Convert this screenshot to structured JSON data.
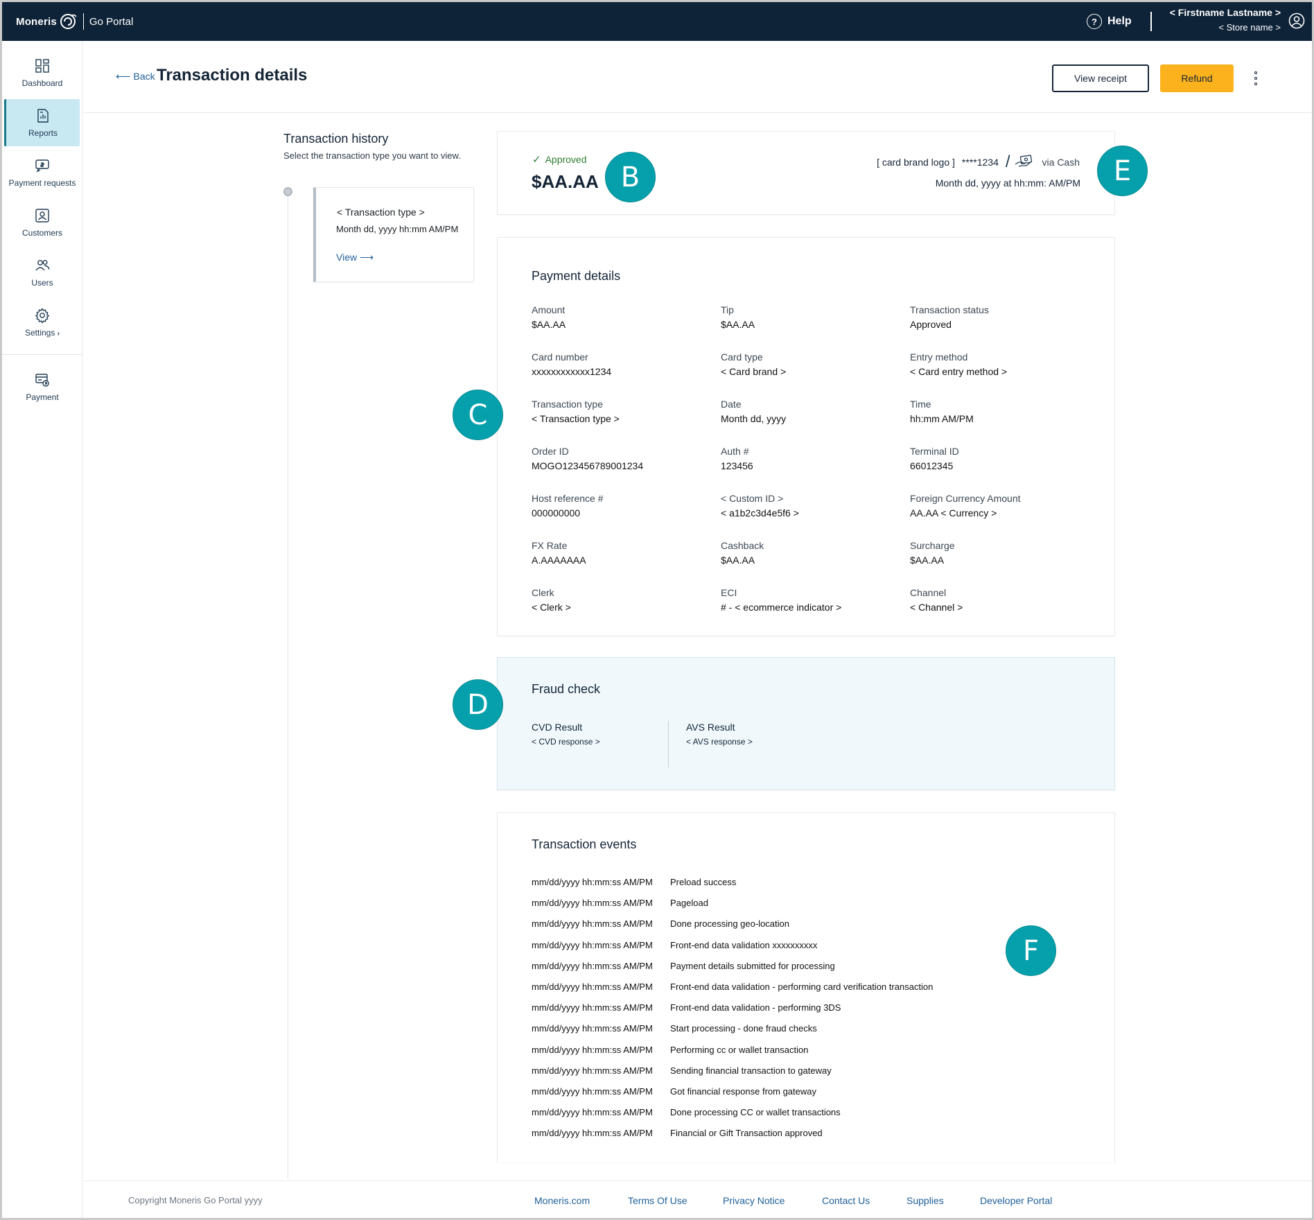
{
  "topbar": {
    "logo_text": "Moneris",
    "portal_name": "Go Portal",
    "help_label": "Help",
    "user_name": "< Firstname Lastname >",
    "store_name": "< Store name >"
  },
  "sidebar": {
    "items": [
      {
        "label": "Dashboard",
        "icon": "dashboard-icon"
      },
      {
        "label": "Reports",
        "icon": "reports-icon",
        "active": true
      },
      {
        "label": "Payment requests",
        "icon": "payment-request-icon"
      },
      {
        "label": "Customers",
        "icon": "customers-icon"
      },
      {
        "label": "Users",
        "icon": "users-icon"
      },
      {
        "label": "Settings",
        "icon": "gear-icon"
      },
      {
        "label": "Payment",
        "icon": "payment-icon"
      }
    ]
  },
  "header": {
    "back_label": "Back",
    "title": "Transaction details",
    "view_receipt_label": "View receipt",
    "refund_label": "Refund"
  },
  "history": {
    "title": "Transaction history",
    "subtitle": "Select the transaction type you want to view.",
    "entry": {
      "type": "< Transaction type >",
      "date": "Month dd, yyyy hh:mm AM/PM",
      "view_label": "View"
    }
  },
  "summary": {
    "status": "Approved",
    "amount": "$AA.AA",
    "card_brand": "[ card brand logo ]",
    "card_last4": "****1234",
    "via": "via Cash",
    "datetime": "Month dd, yyyy at hh:mm: AM/PM"
  },
  "payment_details": {
    "title": "Payment details",
    "fields": [
      {
        "label": "Amount",
        "value": "$AA.AA"
      },
      {
        "label": "Tip",
        "value": "$AA.AA"
      },
      {
        "label": "Transaction status",
        "value": "Approved"
      },
      {
        "label": "Card number",
        "value": "xxxxxxxxxxxx1234"
      },
      {
        "label": "Card type",
        "value": "< Card brand >"
      },
      {
        "label": "Entry method",
        "value": "< Card entry method >"
      },
      {
        "label": "Transaction type",
        "value": "< Transaction type >"
      },
      {
        "label": "Date",
        "value": "Month dd, yyyy"
      },
      {
        "label": "Time",
        "value": "hh:mm AM/PM"
      },
      {
        "label": "Order ID",
        "value": "MOGO123456789001234"
      },
      {
        "label": "Auth #",
        "value": "123456"
      },
      {
        "label": "Terminal ID",
        "value": "66012345"
      },
      {
        "label": "Host reference #",
        "value": "000000000"
      },
      {
        "label": "< Custom ID >",
        "value": "< a1b2c3d4e5f6 >"
      },
      {
        "label": "Foreign Currency Amount",
        "value": "AA.AA < Currency >"
      },
      {
        "label": "FX Rate",
        "value": "A.AAAAAAA"
      },
      {
        "label": "Cashback",
        "value": "$AA.AA"
      },
      {
        "label": "Surcharge",
        "value": "$AA.AA"
      },
      {
        "label": "Clerk",
        "value": "< Clerk >"
      },
      {
        "label": "ECI",
        "value": "# - < ecommerce indicator >"
      },
      {
        "label": "Channel",
        "value": "< Channel >"
      }
    ]
  },
  "fraud_check": {
    "title": "Fraud check",
    "cvd_label": "CVD Result",
    "cvd_value": "< CVD response >",
    "avs_label": "AVS Result",
    "avs_value": "< AVS response >"
  },
  "events": {
    "title": "Transaction events",
    "rows": [
      {
        "time": "mm/dd/yyyy hh:mm:ss AM/PM",
        "text": "Preload success"
      },
      {
        "time": "mm/dd/yyyy hh:mm:ss AM/PM",
        "text": "Pageload"
      },
      {
        "time": "mm/dd/yyyy hh:mm:ss AM/PM",
        "text": "Done processing geo-location"
      },
      {
        "time": "mm/dd/yyyy hh:mm:ss AM/PM",
        "text": "Front-end data validation xxxxxxxxxx"
      },
      {
        "time": "mm/dd/yyyy hh:mm:ss AM/PM",
        "text": "Payment details submitted for processing"
      },
      {
        "time": "mm/dd/yyyy hh:mm:ss AM/PM",
        "text": "Front-end data validation - performing card verification transaction"
      },
      {
        "time": "mm/dd/yyyy hh:mm:ss AM/PM",
        "text": "Front-end data validation - performing 3DS"
      },
      {
        "time": "mm/dd/yyyy hh:mm:ss AM/PM",
        "text": "Start processing - done fraud checks"
      },
      {
        "time": "mm/dd/yyyy hh:mm:ss AM/PM",
        "text": "Performing cc or wallet transaction"
      },
      {
        "time": "mm/dd/yyyy hh:mm:ss AM/PM",
        "text": "Sending financial transaction to gateway"
      },
      {
        "time": "mm/dd/yyyy hh:mm:ss AM/PM",
        "text": "Got financial response from gateway"
      },
      {
        "time": "mm/dd/yyyy hh:mm:ss AM/PM",
        "text": "Done processing CC or wallet transactions"
      },
      {
        "time": "mm/dd/yyyy hh:mm:ss AM/PM",
        "text": "Financial or Gift Transaction approved"
      }
    ]
  },
  "markers": [
    "B",
    "C",
    "D",
    "E",
    "F"
  ],
  "footer": {
    "copyright": "Copyright Moneris Go Portal  yyyy",
    "links": [
      "Moneris.com",
      "Terms Of Use",
      "Privacy Notice",
      "Contact Us",
      "Supplies",
      "Developer Portal"
    ]
  },
  "colors": {
    "topbar": "#0e2338",
    "accent_button": "#fbb21d",
    "marker": "#05a0ab",
    "link": "#1f5f99",
    "approved": "#2e7d32",
    "sidebar_active": "#c8e8f2"
  }
}
